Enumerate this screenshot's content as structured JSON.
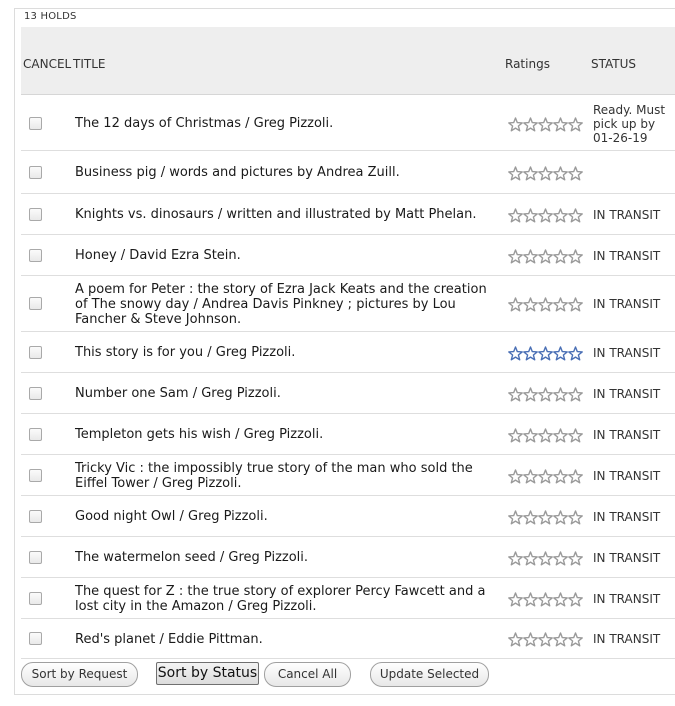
{
  "holds_count": "13 HOLDS",
  "columns": {
    "cancel": "CANCEL",
    "title": "TITLE",
    "ratings": "Ratings",
    "status": "STATUS"
  },
  "holds": [
    {
      "title": "The 12 days of Christmas / Greg Pizzoli.",
      "status": "Ready. Must pick up by 01-26-19",
      "rating_style": "gray"
    },
    {
      "title": "Business pig / words and pictures by Andrea Zuill.",
      "status": "",
      "rating_style": "gray"
    },
    {
      "title": "Knights vs. dinosaurs / written and illustrated by Matt Phelan.",
      "status": "IN TRANSIT",
      "rating_style": "gray"
    },
    {
      "title": "Honey / David Ezra Stein.",
      "status": "IN TRANSIT",
      "rating_style": "gray"
    },
    {
      "title": "A poem for Peter : the story of Ezra Jack Keats and the creation of The snowy day / Andrea Davis Pinkney ; pictures by Lou Fancher & Steve Johnson.",
      "status": "IN TRANSIT",
      "rating_style": "gray"
    },
    {
      "title": "This story is for you / Greg Pizzoli.",
      "status": "IN TRANSIT",
      "rating_style": "blue"
    },
    {
      "title": "Number one Sam / Greg Pizzoli.",
      "status": "IN TRANSIT",
      "rating_style": "gray"
    },
    {
      "title": "Templeton gets his wish / Greg Pizzoli.",
      "status": "IN TRANSIT",
      "rating_style": "gray"
    },
    {
      "title": "Tricky Vic : the impossibly true story of the man who sold the Eiffel Tower / Greg Pizzoli.",
      "status": "IN TRANSIT",
      "rating_style": "gray"
    },
    {
      "title": "Good night Owl / Greg Pizzoli.",
      "status": "IN TRANSIT",
      "rating_style": "gray"
    },
    {
      "title": "The watermelon seed / Greg Pizzoli.",
      "status": "IN TRANSIT",
      "rating_style": "gray"
    },
    {
      "title": "The quest for Z : the true story of explorer Percy Fawcett and a lost city in the Amazon / Greg Pizzoli.",
      "status": "IN TRANSIT",
      "rating_style": "gray"
    },
    {
      "title": "Red's planet / Eddie Pittman.",
      "status": "IN TRANSIT",
      "rating_style": "gray"
    }
  ],
  "buttons": {
    "sort_by_request": "Sort by Request",
    "sort_by_status": "Sort by Status",
    "cancel_all": "Cancel All",
    "update_selected": "Update Selected"
  },
  "colors": {
    "header_bg": "#eeeeee",
    "star_gray": "#9a9a9a",
    "star_blue": "#4a6fb5"
  }
}
